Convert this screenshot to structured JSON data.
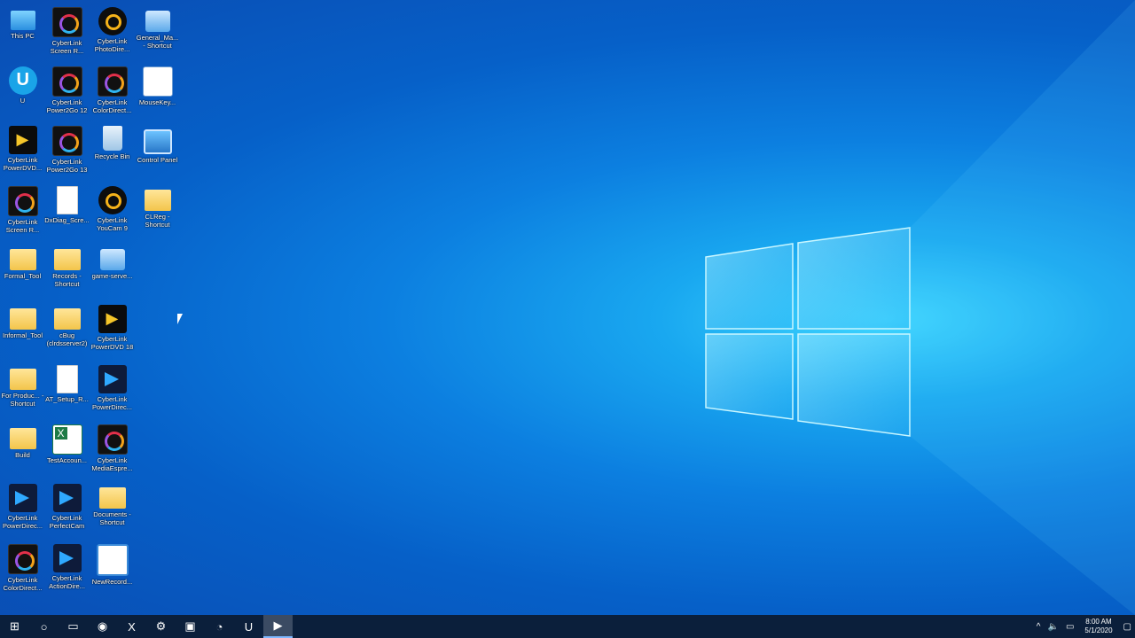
{
  "desktop": {
    "icons": [
      {
        "label": "This PC",
        "kind": "pc"
      },
      {
        "label": "CyberLink Screen R...",
        "kind": "dark"
      },
      {
        "label": "CyberLink PhotoDire...",
        "kind": "round"
      },
      {
        "label": "General_Ma... - Shortcut",
        "kind": "net"
      },
      {
        "label": "U",
        "kind": "u"
      },
      {
        "label": "CyberLink Power2Go 12",
        "kind": "dark"
      },
      {
        "label": "CyberLink ColorDirect...",
        "kind": "dark"
      },
      {
        "label": "MouseKey...",
        "kind": "mk"
      },
      {
        "label": "CyberLink PowerDVD...",
        "kind": "power"
      },
      {
        "label": "CyberLink Power2Go 13",
        "kind": "dark"
      },
      {
        "label": "Recycle Bin",
        "kind": "bin"
      },
      {
        "label": "Control Panel",
        "kind": "cp"
      },
      {
        "label": "CyberLink Screen R...",
        "kind": "dark"
      },
      {
        "label": "DxDiag_Scre...",
        "kind": "doc"
      },
      {
        "label": "CyberLink YouCam 9",
        "kind": "round"
      },
      {
        "label": "CLReg - Shortcut",
        "kind": "folder"
      },
      {
        "label": "Formal_Tool",
        "kind": "folder"
      },
      {
        "label": "Records - Shortcut",
        "kind": "folder"
      },
      {
        "label": "game-serve...",
        "kind": "net"
      },
      {
        "label": "Informal_Tool",
        "kind": "folder"
      },
      {
        "label": "cBug (clrdsserver2)",
        "kind": "folder"
      },
      {
        "label": "CyberLink PowerDVD 18",
        "kind": "power"
      },
      {
        "label": "For Produc... - Shortcut",
        "kind": "folder"
      },
      {
        "label": "AT_Setup_R...",
        "kind": "doc"
      },
      {
        "label": "CyberLink PowerDirec...",
        "kind": "blue"
      },
      {
        "label": "Build",
        "kind": "folder"
      },
      {
        "label": "TestAccoun...",
        "kind": "xl"
      },
      {
        "label": "CyberLink MediaEspre...",
        "kind": "dark"
      },
      {
        "label": "CyberLink PowerDirec...",
        "kind": "blue"
      },
      {
        "label": "CyberLink PerfectCam",
        "kind": "blue"
      },
      {
        "label": "Documents - Shortcut",
        "kind": "folder"
      },
      {
        "label": "CyberLink ColorDirect...",
        "kind": "dark"
      },
      {
        "label": "CyberLink ActionDire...",
        "kind": "blue"
      },
      {
        "label": "NewRecord...",
        "kind": "film"
      }
    ]
  },
  "taskbar": {
    "start_glyph": "⊞",
    "search_glyph": "○",
    "apps": [
      {
        "name": "file-explorer",
        "glyph": "▭"
      },
      {
        "name": "chrome",
        "glyph": "◉"
      },
      {
        "name": "excel",
        "glyph": "X"
      },
      {
        "name": "tool",
        "glyph": "⚙"
      },
      {
        "name": "window-app",
        "glyph": "▣"
      },
      {
        "name": "clock-app",
        "glyph": "◔"
      },
      {
        "name": "u-app",
        "glyph": "U"
      },
      {
        "name": "screen-recorder",
        "glyph": "▶"
      }
    ],
    "tray": {
      "chevron": "^",
      "volume": "🔈",
      "network": "▭",
      "time": "8:00 AM",
      "date": "5/1/2020",
      "notification": "▢"
    }
  }
}
